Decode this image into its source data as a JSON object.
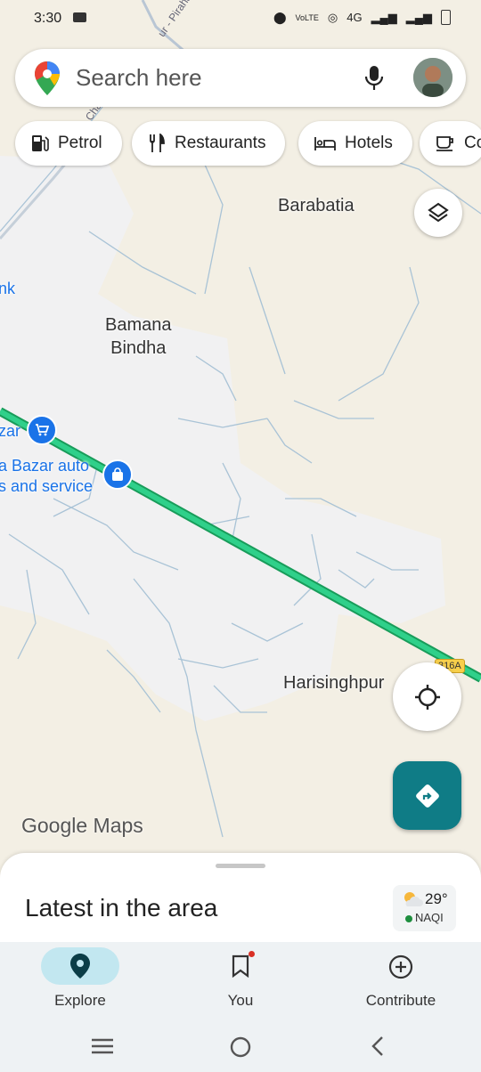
{
  "status_bar": {
    "time": "3:30",
    "network": "4G"
  },
  "search": {
    "placeholder": "Search here"
  },
  "chips": [
    {
      "label": "Petrol",
      "icon": "fuel-icon"
    },
    {
      "label": "Restaurants",
      "icon": "restaurant-icon"
    },
    {
      "label": "Hotels",
      "icon": "hotel-icon"
    },
    {
      "label": "Co",
      "icon": "coffee-icon"
    }
  ],
  "map": {
    "places": [
      "Barabatia",
      "Bamana\nBindha",
      "Harisinghpur"
    ],
    "poi": [
      "zar",
      "a Bazar auto",
      "s and service",
      "nk"
    ],
    "road_text": "ur - Piraha",
    "road_text2": "Cha",
    "route_shield": "316A",
    "watermark": "Google Maps"
  },
  "sheet": {
    "title": "Latest in the area",
    "temperature": "29°",
    "aqi": "NAQI"
  },
  "bottom_nav": [
    {
      "label": "Explore",
      "icon": "explore-pin-icon",
      "active": true
    },
    {
      "label": "You",
      "icon": "bookmark-icon",
      "active": false
    },
    {
      "label": "Contribute",
      "icon": "add-circle-icon",
      "active": false
    }
  ],
  "colors": {
    "teal": "#0f7c86",
    "route": "#2fd08a",
    "accent": "#1a73e8"
  }
}
